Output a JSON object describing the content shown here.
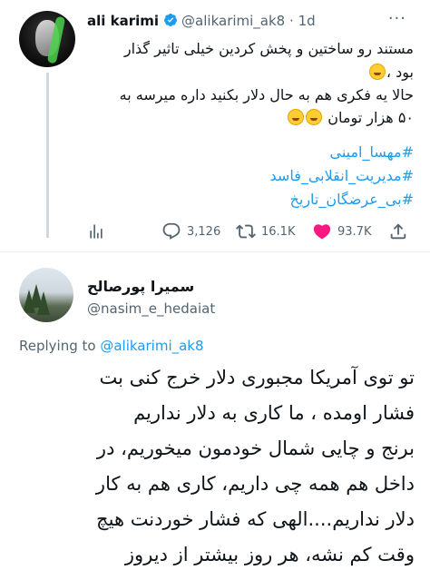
{
  "parent_tweet": {
    "display_name": "ali karimi",
    "handle": "@alikarimi_ak8",
    "separator": "·",
    "time": "1d",
    "more_label": "···",
    "lines": [
      "مستند رو ساختین و پخش کردین خیلی تاثیر گذار",
      "بود ،",
      "حالا یه فکری هم به حال دلار بکنید داره میرسه به",
      "۵۰ هزار تومان"
    ],
    "hashtags": [
      "#مهسا_امینی",
      "#مدیریت_انقلابی_فاسد",
      "#بی_عرضگان_تاریخ"
    ],
    "stats": {
      "replies": "3,126",
      "retweets": "16.1K",
      "likes": "93.7K"
    },
    "colors": {
      "like": "#f91880",
      "link": "#1d9bf0",
      "verified": "#1d9bf0"
    }
  },
  "reply_tweet": {
    "display_name": "سمیرا پورصالح",
    "handle": "@nasim_e_hedaiat",
    "replying_prefix": "Replying to",
    "replying_to": "@alikarimi_ak8",
    "lines": [
      "تو توی آمریکا مجبوری دلار خرج کنی بت",
      "فشار اومده ، ما کاری به دلار نداریم",
      "برنج و چایی شمال خودمون میخوریم، در",
      "داخل هم همه چی داریم، کاری هم به کار",
      "دلار نداریم....الهی که فشار خوردنت هیچ",
      "وقت کم نشه، هر روز بیشتر از دیروز"
    ]
  },
  "icons": [
    "verified-badge-icon",
    "views-icon",
    "reply-icon",
    "retweet-icon",
    "like-heart-icon",
    "share-icon",
    "laughing-emoji-icon",
    "tears-of-joy-emoji-icon"
  ]
}
